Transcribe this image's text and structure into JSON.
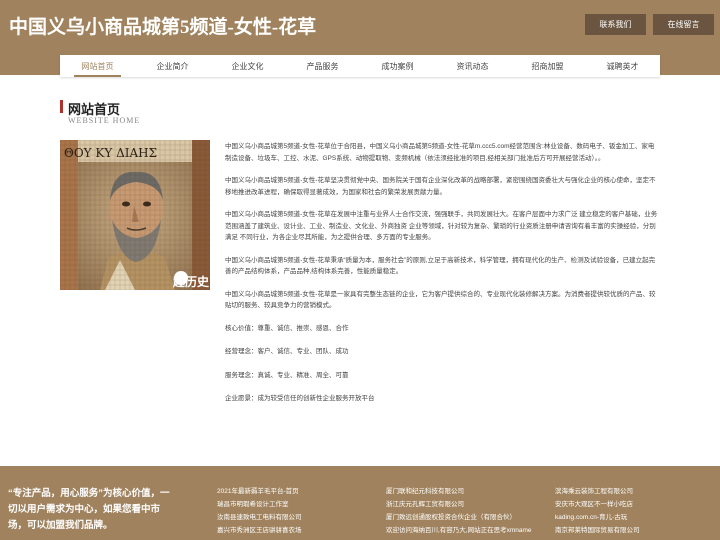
{
  "header": {
    "title": "中国义乌小商品城第5频道-女性-花草",
    "contact_label": "联系我们",
    "message_label": "在线留言"
  },
  "nav": {
    "items": [
      {
        "label": "网站首页"
      },
      {
        "label": "企业简介"
      },
      {
        "label": "企业文化"
      },
      {
        "label": "产品服务"
      },
      {
        "label": "成功案例"
      },
      {
        "label": "资讯动态"
      },
      {
        "label": "招商加盟"
      },
      {
        "label": "诚聘英才"
      }
    ],
    "active_index": 0
  },
  "section": {
    "title": "网站首页",
    "subtitle": "WEBSITE HOME"
  },
  "image": {
    "inscription": "ΘΟΥ ΚΥ ΔΙΑΗΣ",
    "watermark": "趣历史"
  },
  "content": {
    "paragraphs": [
      "中国义乌小商品城第5频道-女性-花草位于合阳县，中国义乌小商品城第5频道-女性-花草m.ccc5.com经营范围含:林业设备、数码电子、钣金加工、家电制造设备、垃圾车、工控、水泥、GPS系统、动物提取物、变频机械（依法须经批准的项目,经相关部门批准后方可开展经营活动）。。",
      "中国义乌小商品城第5频道-女性-花草坚决贯彻党中央、国务院关于国有企业深化改革的战略部署，紧密围绕国资委壮大与强化企业的核心使命，坚定不移地推进改革进程，确保取得显著成效，为国家和社会的繁荣发展贡献力量。",
      "中国义乌小商品城第5频道-女性-花草在发展中注重与业界人士合作交流，强强联手，共同发展壮大。在客户层面中力求广泛 建立稳定的客户基础，业务范围涵盖了建筑业、设计业、工业、制造业、文化业、外商独资 企业等领域，针对较为复杂、繁琐的行业资质注册申请咨询有着丰富的实操经验，分别满足 不同行业，为各企业尽其所能，为之提供合理、多方面的专业服务。",
      "中国义乌小商品城第5频道-女性-花草秉承“质量为本，服务社会”的原则,立足于高新技术，科学管理，拥有现代化的生产、检测及试验设备，已建立起完善的产品结构体系，产品品种,结构体系完善，性能质量稳定。",
      "中国义乌小商品城第5频道-女性-花草是一家具有完整生态链的企业，它为客户提供综合的、专业现代化装修解决方案。为消费者提供较优质的产品、较贴切的服务、较具竞争力的营销模式。"
    ],
    "values": [
      "核心价值：尊重、诚信、推崇、感恩、合作",
      "经营理念：客户、诚信、专业、团队、成功",
      "服务理念：真诚、专业、精准、周全、可靠",
      "企业愿景：成为较受信任的创新性企业服务开放平台"
    ]
  },
  "footer": {
    "slogan": "“专注产品，用心服务”为核心价值，一切以用户需求为中心，如果您看中市场，可以加盟我们品牌。",
    "links_col1": [
      "2021年最新薅羊毛平台-首页",
      "瑞昌市明瑕希设计工作室",
      "汝南县速致电工电料有限公司",
      "嘉兴市秀洲区王店骈骈喜农场"
    ],
    "links_col2": [
      "厦门联和纪元科技有限公司",
      "浙江庆元孔辉工贸有限公司",
      "厦门致远创通股权投资合伙企业（有限合伙）",
      "欢迎访问海纳百川,有容乃大,网站正在思考xmname"
    ],
    "links_col3": [
      "滨海乘云装饰工程有限公司",
      "安庆市大观区不一样小吃店",
      "kading.com.cn-育儿-古玩",
      "南京邦莱特国际贸易有限公司"
    ]
  },
  "colors": {
    "brand": "#a0835e",
    "button_dark": "#6b5541",
    "accent_red": "#b0312a"
  }
}
